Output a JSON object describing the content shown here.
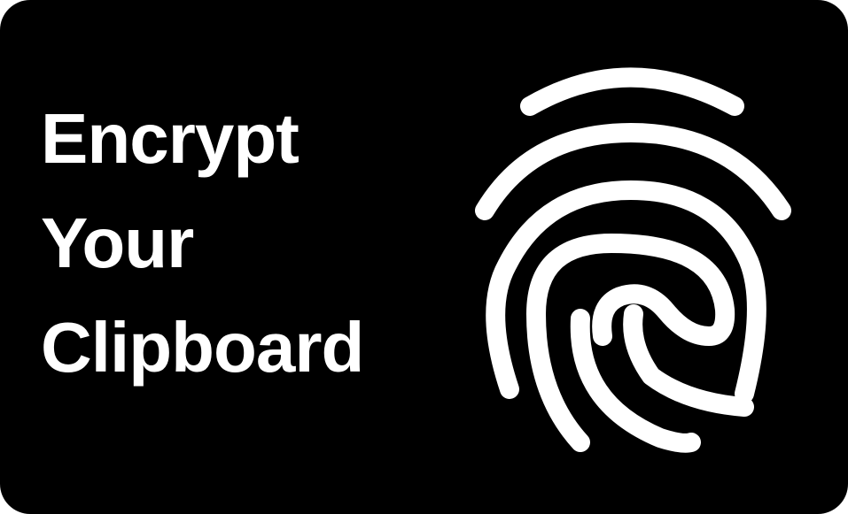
{
  "headline": {
    "line1": "Encrypt",
    "line2": "Your",
    "line3": "Clipboard"
  },
  "icon": "fingerprint-icon",
  "colors": {
    "background": "#000000",
    "foreground": "#ffffff"
  }
}
